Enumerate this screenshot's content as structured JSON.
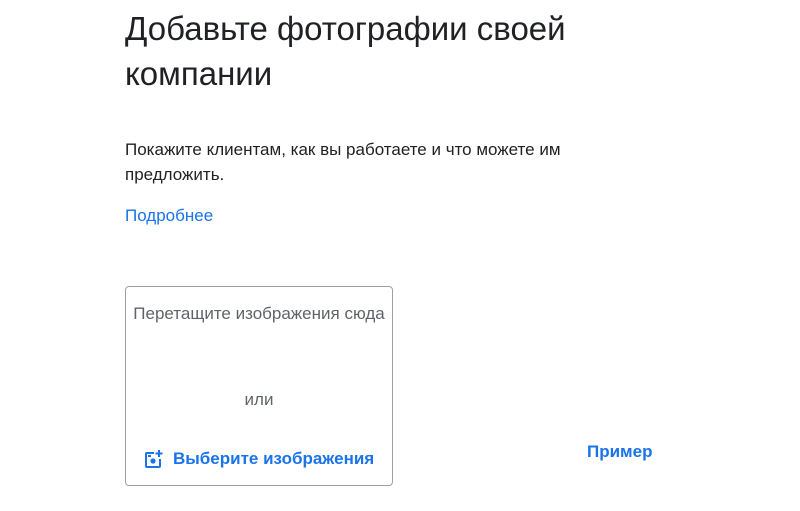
{
  "header": {
    "title": "Добавьте фотографии своей компании"
  },
  "body": {
    "description": "Покажите клиентам, как вы работаете и что можете им предложить.",
    "learn_more": "Подробнее"
  },
  "dropzone": {
    "drag_text": "Перетащите изображения сюда",
    "or_text": "или",
    "choose_label": "Выберите изображения",
    "choose_icon": "add-photo-icon"
  },
  "example": {
    "label": "Пример"
  },
  "colors": {
    "accent": "#1a73e8",
    "text_primary": "#202124",
    "text_secondary": "#5f6368",
    "border": "#9aa0a6"
  }
}
